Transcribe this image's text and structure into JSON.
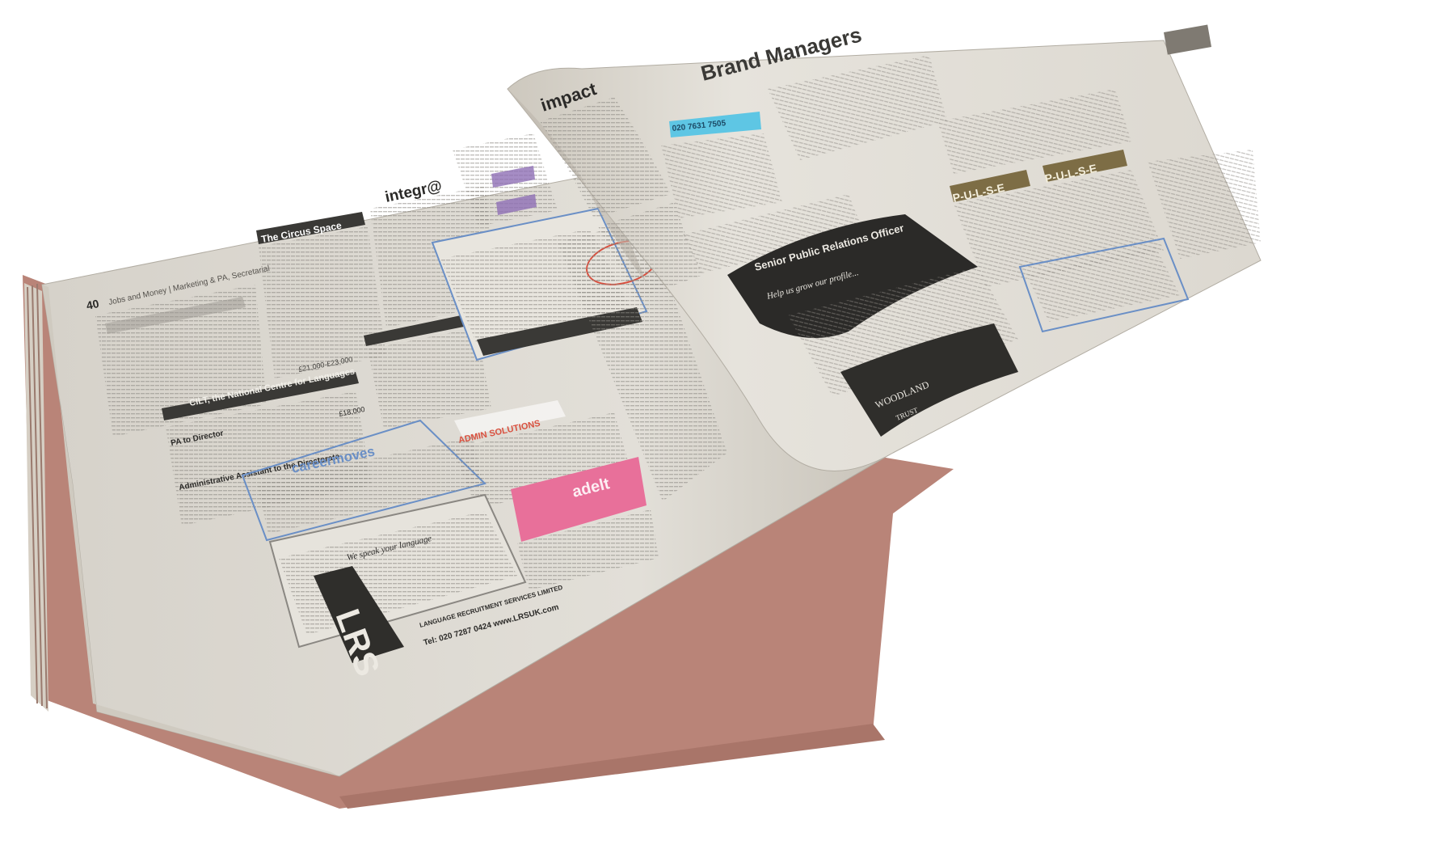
{
  "left_page": {
    "page_number": "40",
    "header": "Jobs and Money | Marketing & PA, Secretarial",
    "ads": {
      "circus_space": "The Circus Space",
      "integra": "integr@",
      "cilt": "CILT, the National Centre for Languages",
      "pa_to_director": "PA to Director",
      "admin_assistant": "Administrative Assistant to the Directorate",
      "careermoves": "careermoves",
      "admin_solutions": "ADMIN SOLUTIONS",
      "adelt": "adelt",
      "we_speak": "We speak your language",
      "lrs_logo": "LRS",
      "lrs_name": "LANGUAGE RECRUITMENT SERVICES LIMITED",
      "lrs_contact": "Tel: 020 7287 0424 www.LRSUK.com",
      "salary_1": "£21,000-£23,000",
      "salary_2": "£18,000"
    }
  },
  "right_page": {
    "ads": {
      "impact": "impact",
      "brand_managers": "Brand Managers",
      "phone_banner": "020 7631 7505",
      "pulse_1": "P-U-L-S-E",
      "pulse_2": "P-U-L-S-E",
      "spro_title": "Senior Public Relations Officer",
      "spro_sub": "Help us grow our profile...",
      "woodland": "WOODLAND",
      "woodland_sub": "TRUST"
    }
  },
  "colors": {
    "paper": "#e4e0d8",
    "paper_shadow": "#c9c4ba",
    "edge_pink": "#b98478",
    "ink_dark": "#2b2a28",
    "ad_pink": "#e8709a",
    "ad_blue": "#6a8fc6",
    "ad_cyan": "#5ec6e4",
    "ad_purple": "#8e6fb5",
    "ad_red": "#d9503f"
  }
}
